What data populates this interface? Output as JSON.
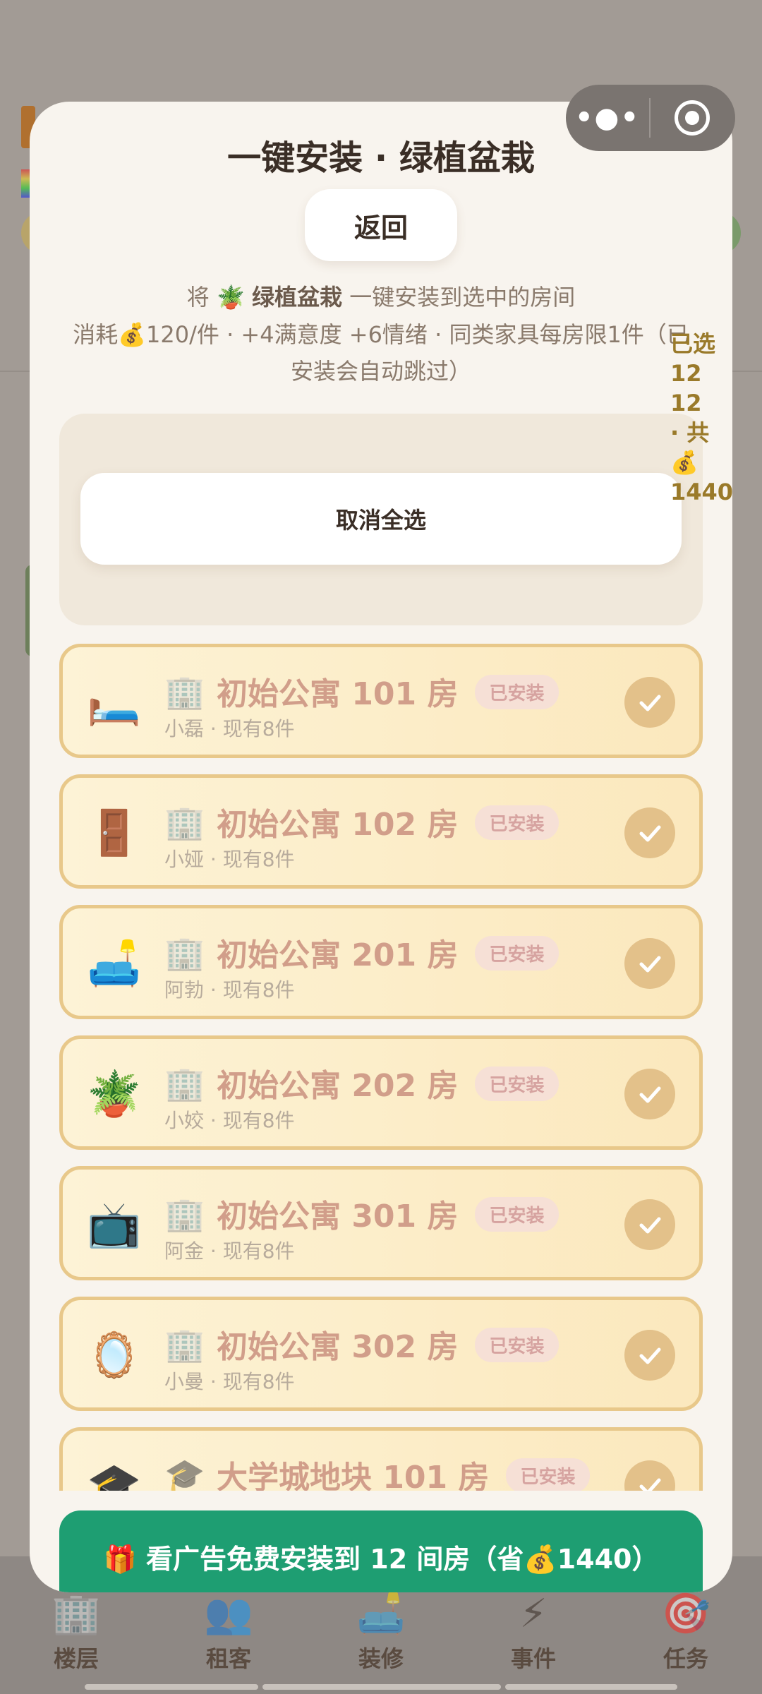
{
  "capsule": {
    "more_icon": "more-dots-icon",
    "close_icon": "close-target-icon"
  },
  "modal": {
    "title": "一键安装 · 绿植盆栽",
    "back_label": "返回",
    "desc_prefix": "将",
    "desc_item_icon": "🪴",
    "desc_item": "绿植盆栽",
    "desc_suffix": "一键安装到选中的房间",
    "desc_detail": "消耗💰120/件 · +4满意度 +6情绪 · 同类家具每房限1件（已安装会自动跳过）",
    "deselect_label": "取消全选",
    "side_info": [
      "已选",
      "12",
      "12",
      "· 共",
      "💰",
      "1440"
    ]
  },
  "rooms": [
    {
      "icon": "🛏️",
      "building_icon": "🏢",
      "name": "初始公寓 101 房",
      "badge": "已安装",
      "sub": "小磊 · 现有8件",
      "checked": true
    },
    {
      "icon": "🚪",
      "building_icon": "🏢",
      "name": "初始公寓 102 房",
      "badge": "已安装",
      "sub": "小娅 · 现有8件",
      "checked": true
    },
    {
      "icon": "🛋️",
      "building_icon": "🏢",
      "name": "初始公寓 201 房",
      "badge": "已安装",
      "sub": "阿勃 · 现有8件",
      "checked": true
    },
    {
      "icon": "🪴",
      "building_icon": "🏢",
      "name": "初始公寓 202 房",
      "badge": "已安装",
      "sub": "小姣 · 现有8件",
      "checked": true
    },
    {
      "icon": "📺",
      "building_icon": "🏢",
      "name": "初始公寓 301 房",
      "badge": "已安装",
      "sub": "阿金 · 现有8件",
      "checked": true
    },
    {
      "icon": "🪞",
      "building_icon": "🏢",
      "name": "初始公寓 302 房",
      "badge": "已安装",
      "sub": "小曼 · 现有8件",
      "checked": true
    },
    {
      "icon": "🎓",
      "building_icon": "🎓",
      "name": "大学城地块 101 房",
      "badge": "已安装",
      "sub": "",
      "checked": true
    }
  ],
  "ad_button": {
    "label": "🎁 看广告免费安装到 12 间房（省💰1440）"
  },
  "bottom_nav": [
    {
      "icon": "🏢",
      "label": "楼层"
    },
    {
      "icon": "👥",
      "label": "租客"
    },
    {
      "icon": "🛋️",
      "label": "装修"
    },
    {
      "icon": "⚡",
      "label": "事件"
    },
    {
      "icon": "🎯",
      "label": "任务"
    }
  ],
  "colors": {
    "accent_green": "#1e9e72",
    "card_border": "#e8c88a",
    "check": "#e3c18a"
  }
}
